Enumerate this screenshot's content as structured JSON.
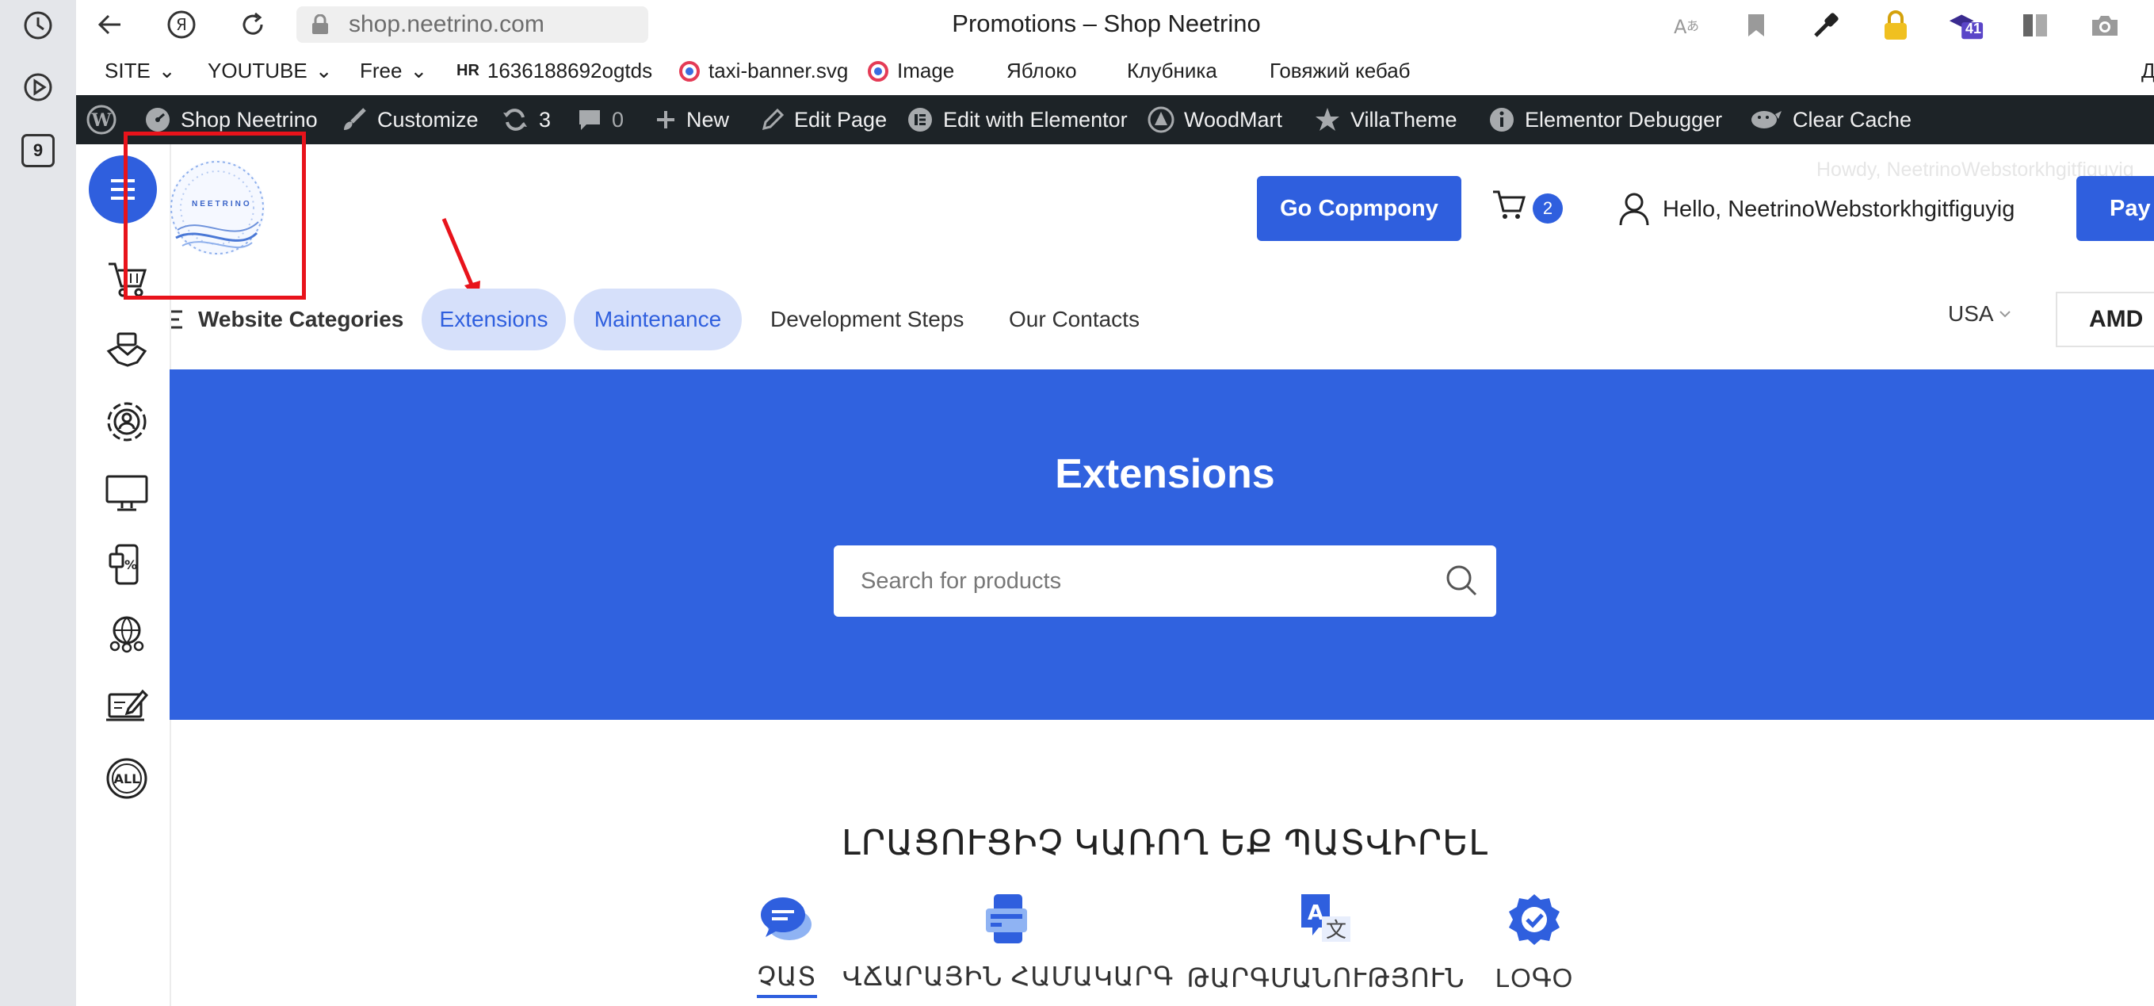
{
  "browser": {
    "url": "shop.neetrino.com",
    "window_title": "Promotions – Shop Neetrino",
    "sidebar_badge": "9",
    "ext_badge": "41"
  },
  "bookmarks": [
    {
      "label": "SITE",
      "caret": true
    },
    {
      "label": "YOUTUBE",
      "caret": true
    },
    {
      "label": "Free",
      "caret": true
    },
    {
      "label": "1636188692ogtds",
      "icon": "hr-icon"
    },
    {
      "label": "taxi-banner.svg",
      "icon": "circle-icon"
    },
    {
      "label": "Image",
      "icon": "circle-icon"
    },
    {
      "label": "Яблоко"
    },
    {
      "label": "Клубника"
    },
    {
      "label": "Говяжий кебаб"
    },
    {
      "label": "Д"
    }
  ],
  "wp_bar": {
    "site": "Shop Neetrino",
    "customize": "Customize",
    "updates": "3",
    "comments": "0",
    "new": "New",
    "edit_page": "Edit Page",
    "edit_elementor": "Edit with Elementor",
    "woodmart": "WoodMart",
    "villatheme": "VillaTheme",
    "debugger": "Elementor Debugger",
    "clear_cache": "Clear Cache"
  },
  "header": {
    "logo_text": "NEETRINO",
    "go_button": "Go Copmpony",
    "cart_count": "2",
    "hello": "Hello, NeetrinoWebstorkhgitfiguyig",
    "howdy": "Howdy, NeetrinoWebstorkhgitfiguyig",
    "pay_button": "Pay"
  },
  "nav": {
    "categories": "Website Categories",
    "extensions": "Extensions",
    "maintenance": "Maintenance",
    "dev_steps": "Development Steps",
    "contacts": "Our Contacts",
    "country": "USA",
    "currency": "AMD"
  },
  "hero": {
    "title": "Extensions",
    "search_placeholder": "Search for products"
  },
  "section": {
    "title": "ԼՐԱՑՈՒՑԻՉ ԿԱՌՈՂ ԵՔ ՊԱՏՎԻՐԵԼ",
    "features": [
      {
        "label": "ՉԱՏ",
        "icon": "chat-icon",
        "active": true
      },
      {
        "label": "ՎՃԱՐԱՅԻՆ ՀԱՄԱԿԱՐԳ",
        "icon": "payment-card-icon",
        "active": false
      },
      {
        "label": "ԹԱՐԳՄԱՆՈՒԹՅՈՒՆ",
        "icon": "translate-icon",
        "active": false
      },
      {
        "label": "LOԳO",
        "icon": "verified-badge-icon",
        "active": false
      }
    ]
  },
  "colors": {
    "primary": "#2f5fde",
    "hero": "#3062df",
    "wp_bar": "#1d2327",
    "annotation": "#e8131b"
  }
}
